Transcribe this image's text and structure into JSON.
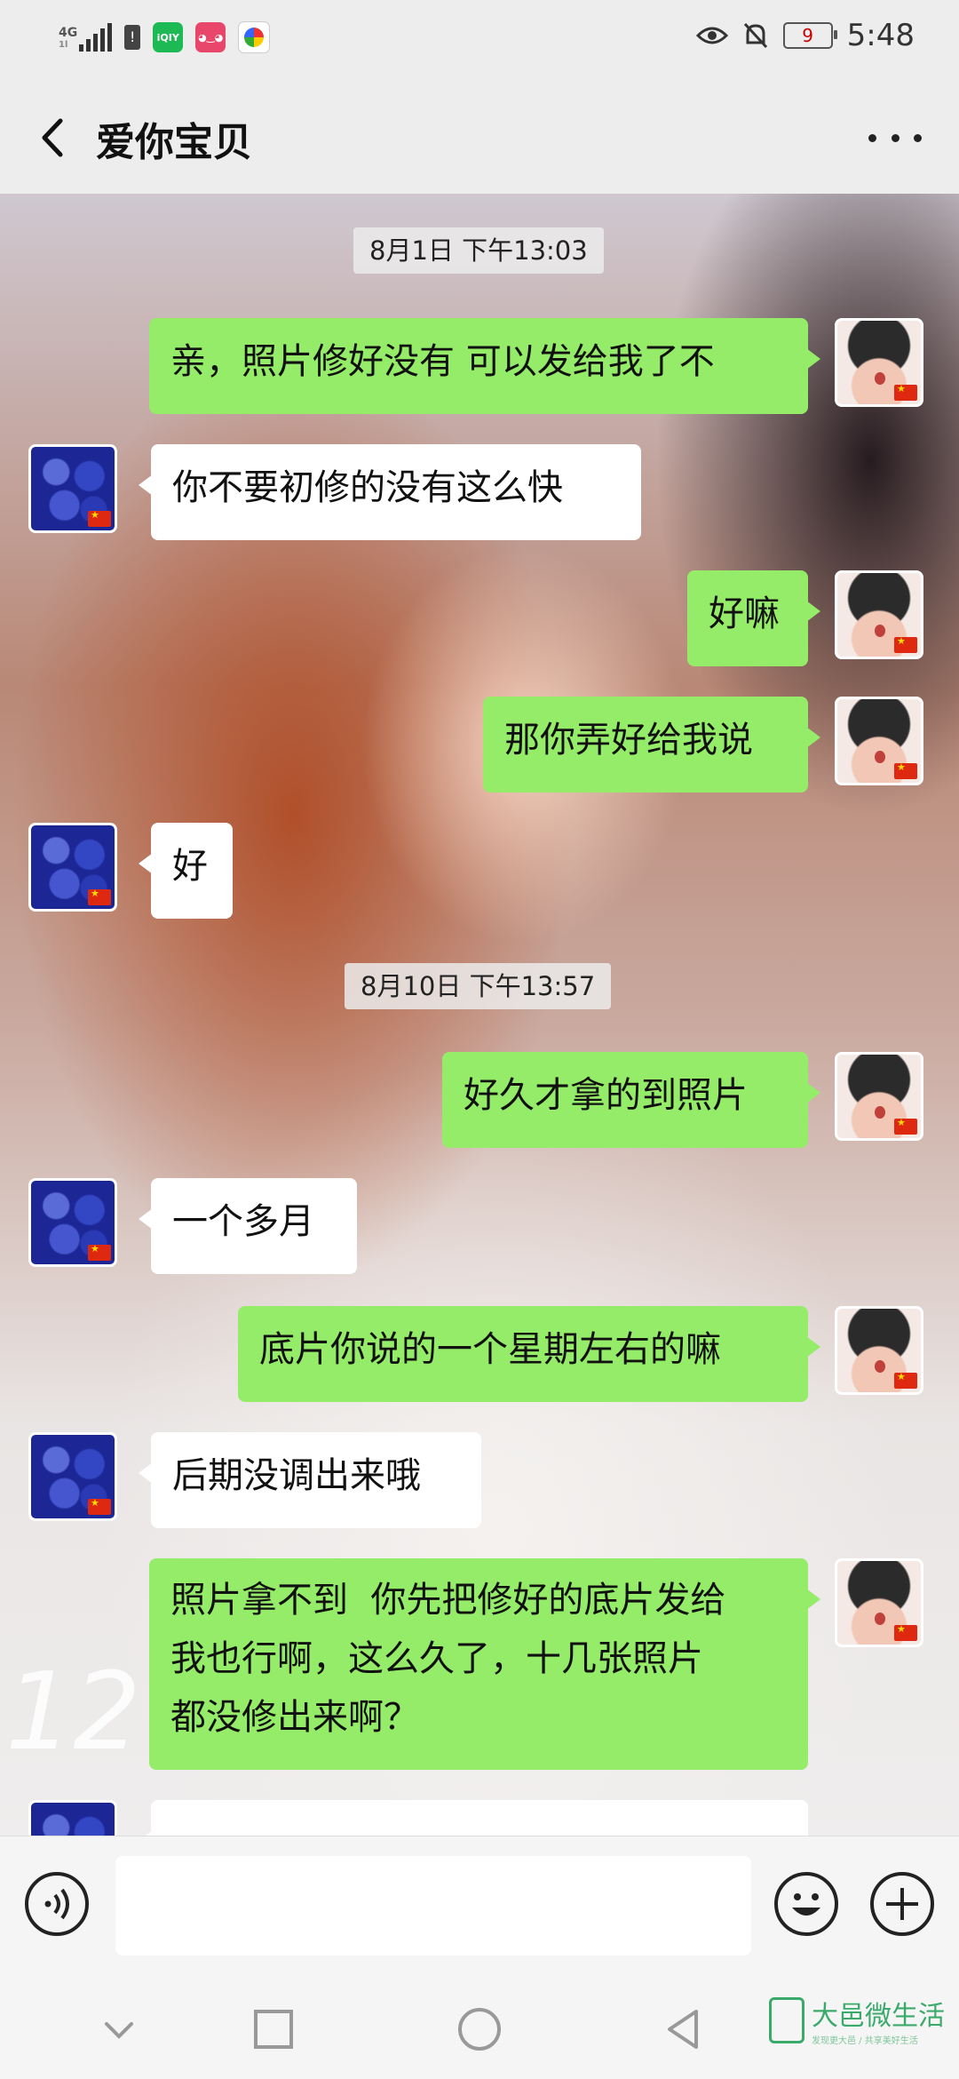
{
  "status_bar": {
    "network": "4G",
    "network_sub": "1l",
    "app_icon_1": "iQIY",
    "battery": "9",
    "time": "5:48"
  },
  "header": {
    "title": "爱你宝贝"
  },
  "chat": {
    "background_text": "12",
    "timestamps": [
      "8月1日 下午13:03",
      "8月10日 下午13:57"
    ],
    "messages": [
      {
        "from": "self",
        "text": "亲，照片修好没有 可以发给我了不"
      },
      {
        "from": "other",
        "text": "你不要初修的没有这么快"
      },
      {
        "from": "self",
        "text": "好嘛"
      },
      {
        "from": "self",
        "text": "那你弄好给我说"
      },
      {
        "from": "other",
        "text": "好"
      },
      {
        "from": "self",
        "text": "好久才拿的到照片"
      },
      {
        "from": "other",
        "text": "一个多月"
      },
      {
        "from": "self",
        "text": "底片你说的一个星期左右的嘛"
      },
      {
        "from": "other",
        "text": "后期没调出来哦"
      },
      {
        "from": "self",
        "text": "照片拿不到  你先把修好的底片发给\n我也行啊，这么久了，十几张照片\n都没修出来啊？"
      }
    ]
  },
  "watermark": {
    "text": "大邑微生活",
    "subtext": "发现更大邑 / 共享美好生活"
  },
  "colors": {
    "self_bubble": "#95ec69",
    "other_bubble": "#ffffff",
    "background": "#ededed"
  },
  "icons": [
    "back-arrow-icon",
    "more-icon",
    "voice-icon",
    "emoji-icon",
    "plus-icon",
    "nav-back-icon",
    "nav-home-icon",
    "nav-recent-icon",
    "nav-down-icon"
  ]
}
